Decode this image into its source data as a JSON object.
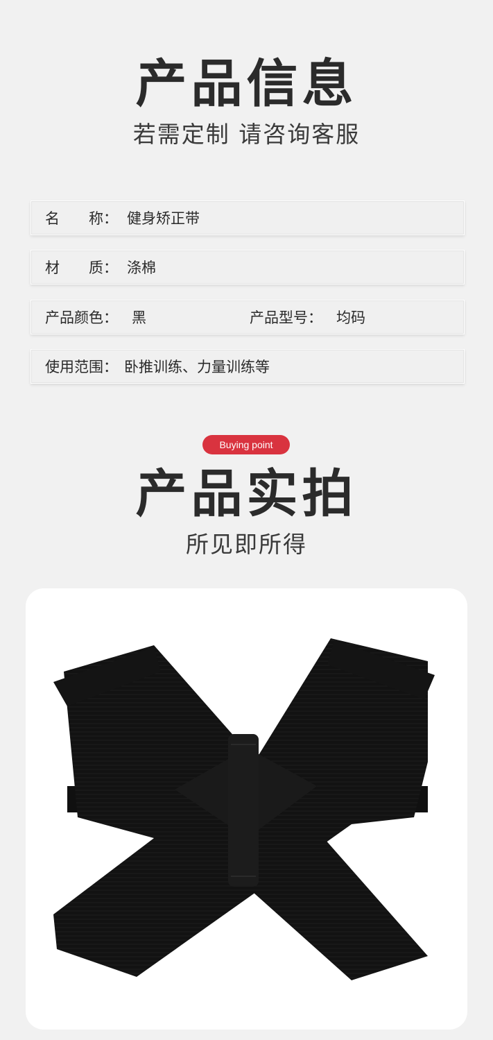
{
  "info": {
    "title": "产品信息",
    "subtitle": "若需定制 请咨询客服",
    "rows": [
      {
        "label": "名　　称：",
        "value": "健身矫正带"
      },
      {
        "label": "材　　质：",
        "value": "涤棉"
      },
      {
        "label": "产品颜色：",
        "value": "黑",
        "label2": "产品型号：",
        "value2": "均码"
      },
      {
        "label": "使用范围：",
        "value": "卧推训练、力量训练等"
      }
    ]
  },
  "showcase": {
    "badge": "Buying point",
    "title": "产品实拍",
    "subtitle": "所见即所得",
    "photo_alt": "black cross-back posture corrector strap"
  },
  "colors": {
    "background": "#f1f1f1",
    "badge": "#d9333f",
    "strap": "#111111"
  }
}
